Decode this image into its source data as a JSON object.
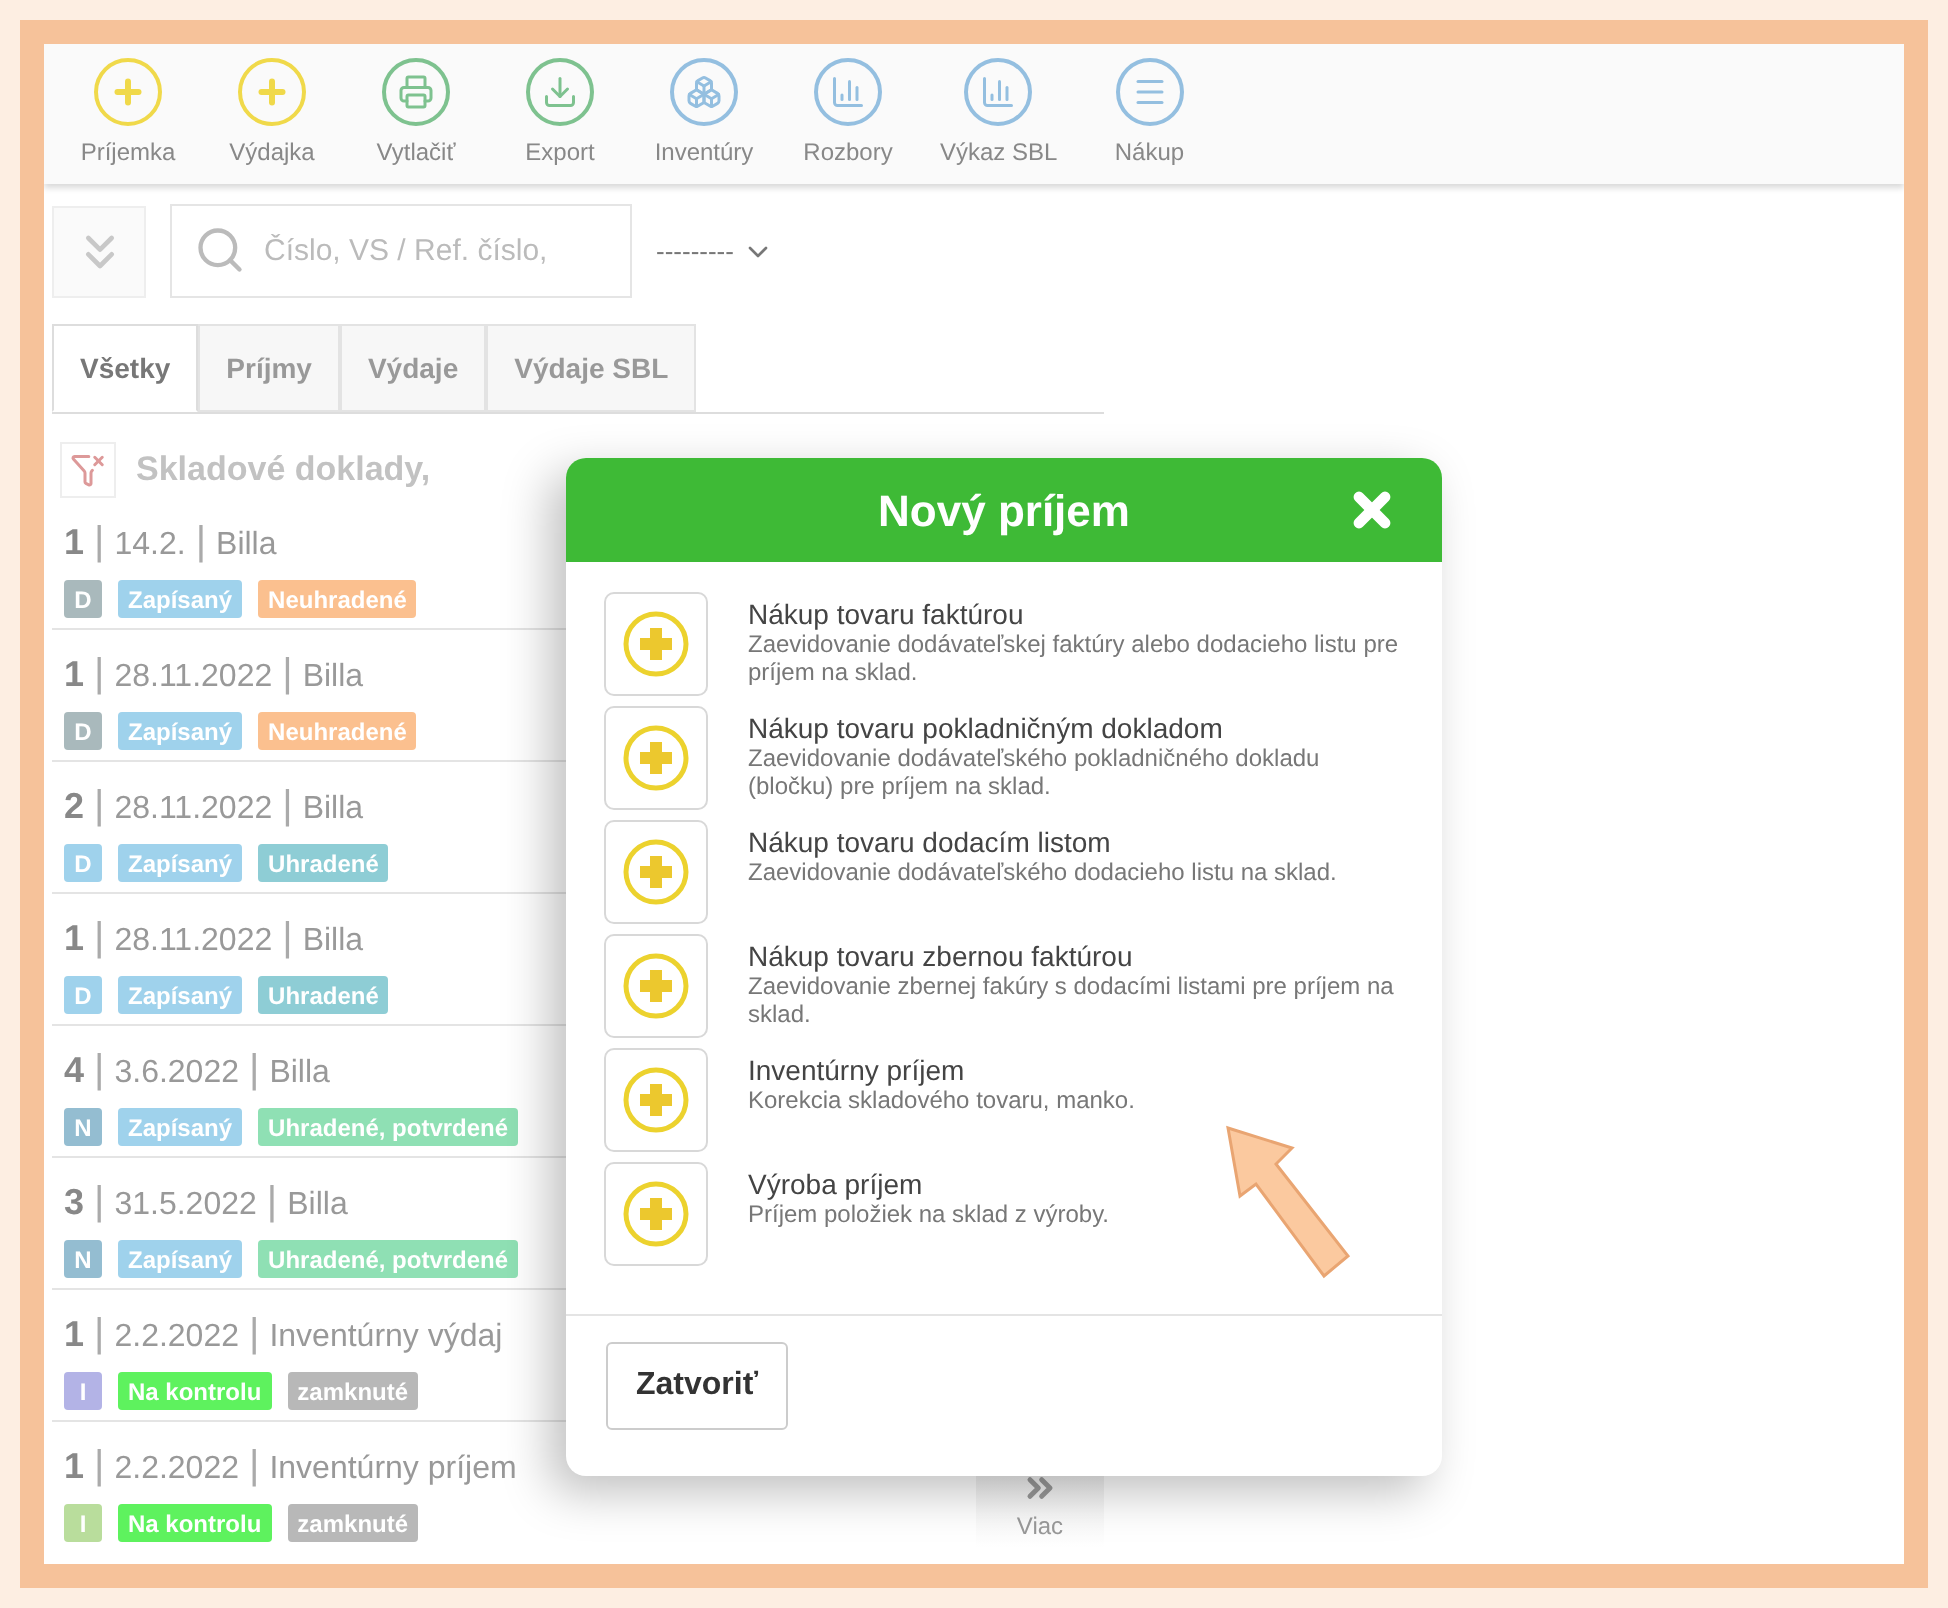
{
  "toolbar": [
    {
      "label": "Príjemka",
      "kind": "plus"
    },
    {
      "label": "Výdajka",
      "kind": "plus"
    },
    {
      "label": "Vytlačiť",
      "kind": "print"
    },
    {
      "label": "Export",
      "kind": "export"
    },
    {
      "label": "Inventúry",
      "kind": "boxes"
    },
    {
      "label": "Rozbory",
      "kind": "chart"
    },
    {
      "label": "Výkaz SBL",
      "kind": "chart"
    },
    {
      "label": "Nákup",
      "kind": "menu"
    }
  ],
  "search": {
    "placeholder": "Číslo, VS / Ref. číslo,"
  },
  "filter_select": {
    "value": "---------"
  },
  "tabs": [
    {
      "label": "Všetky",
      "selected": true
    },
    {
      "label": "Príjmy",
      "selected": false
    },
    {
      "label": "Výdaje",
      "selected": false
    },
    {
      "label": "Výdaje SBL",
      "selected": false
    }
  ],
  "list_title": "Skladové doklady,",
  "documents": [
    {
      "number": "1",
      "date": "14.2.",
      "partner": "Billa",
      "separators": [
        "|",
        "|"
      ],
      "badges": [
        {
          "text": "D",
          "color": "#a9b9bc"
        },
        {
          "text": "Zapísaný",
          "color": "#9fd2ec"
        },
        {
          "text": "Neuhradené",
          "color": "#fbc08f"
        }
      ]
    },
    {
      "number": "1",
      "date": "28.11.2022",
      "partner": "Billa",
      "separators": [
        "|",
        "|"
      ],
      "badges": [
        {
          "text": "D",
          "color": "#a9b9bc"
        },
        {
          "text": "Zapísaný",
          "color": "#9fd2ec"
        },
        {
          "text": "Neuhradené",
          "color": "#fbc08f"
        }
      ]
    },
    {
      "number": "2",
      "date": "28.11.2022",
      "partner": "Billa",
      "separators": [
        "|",
        "|"
      ],
      "badges": [
        {
          "text": "D",
          "color": "#9fd2ec"
        },
        {
          "text": "Zapísaný",
          "color": "#9fd2ec"
        },
        {
          "text": "Uhradené",
          "color": "#8ecdd5"
        }
      ]
    },
    {
      "number": "1",
      "date": "28.11.2022",
      "partner": "Billa",
      "separators": [
        "|",
        "|"
      ],
      "badges": [
        {
          "text": "D",
          "color": "#9fd2ec"
        },
        {
          "text": "Zapísaný",
          "color": "#9fd2ec"
        },
        {
          "text": "Uhradené",
          "color": "#8ecdd5"
        }
      ]
    },
    {
      "number": "4",
      "date": "3.6.2022",
      "partner": "Billa",
      "separators": [
        "|",
        "|"
      ],
      "badges": [
        {
          "text": "N",
          "color": "#94bdd1"
        },
        {
          "text": "Zapísaný",
          "color": "#9fd2ec"
        },
        {
          "text": "Uhradené, potvrdené",
          "color": "#8fe0b4"
        }
      ]
    },
    {
      "number": "3",
      "date": "31.5.2022",
      "partner": "Billa",
      "separators": [
        "|",
        "|"
      ],
      "badges": [
        {
          "text": "N",
          "color": "#94bdd1"
        },
        {
          "text": "Zapísaný",
          "color": "#9fd2ec"
        },
        {
          "text": "Uhradené, potvrdené",
          "color": "#8fe0b4"
        }
      ]
    },
    {
      "number": "1",
      "date": "2.2.2022",
      "partner": "Inventúrny výdaj",
      "separators": [
        "|",
        "|"
      ],
      "badges": [
        {
          "text": "I",
          "color": "#b3b3e6"
        },
        {
          "text": "Na kontrolu",
          "color": "#5ef25e"
        },
        {
          "text": "zamknuté",
          "color": "#b8b8b8"
        }
      ]
    },
    {
      "number": "1",
      "date": "2.2.2022",
      "partner": "Inventúrny príjem",
      "separators": [
        "|",
        "|"
      ],
      "badges": [
        {
          "text": "I",
          "color": "#b9dd9c"
        },
        {
          "text": "Na kontrolu",
          "color": "#5ef25e"
        },
        {
          "text": "zamknuté",
          "color": "#b8b8b8"
        }
      ]
    }
  ],
  "more": {
    "label": "Viac"
  },
  "dialog": {
    "title": "Nový príjem",
    "options": [
      {
        "title": "Nákup tovaru faktúrou",
        "description": "Zaevidovanie dodávateľskej faktúry alebo dodacieho listu pre príjem na sklad."
      },
      {
        "title": "Nákup tovaru pokladničným dokladom",
        "description": "Zaevidovanie dodávateľského pokladničného dokladu (bločku) pre príjem na sklad."
      },
      {
        "title": "Nákup tovaru dodacím listom",
        "description": "Zaevidovanie dodávateľského dodacieho listu na sklad."
      },
      {
        "title": "Nákup tovaru zbernou faktúrou",
        "description": "Zaevidovanie zbernej fakúry s dodacími listami pre príjem na sklad."
      },
      {
        "title": "Inventúrny príjem",
        "description": "Korekcia skladového tovaru, manko."
      },
      {
        "title": "Výroba príjem",
        "description": "Príjem položiek na sklad z výroby."
      }
    ],
    "close_button": "Zatvoriť"
  }
}
